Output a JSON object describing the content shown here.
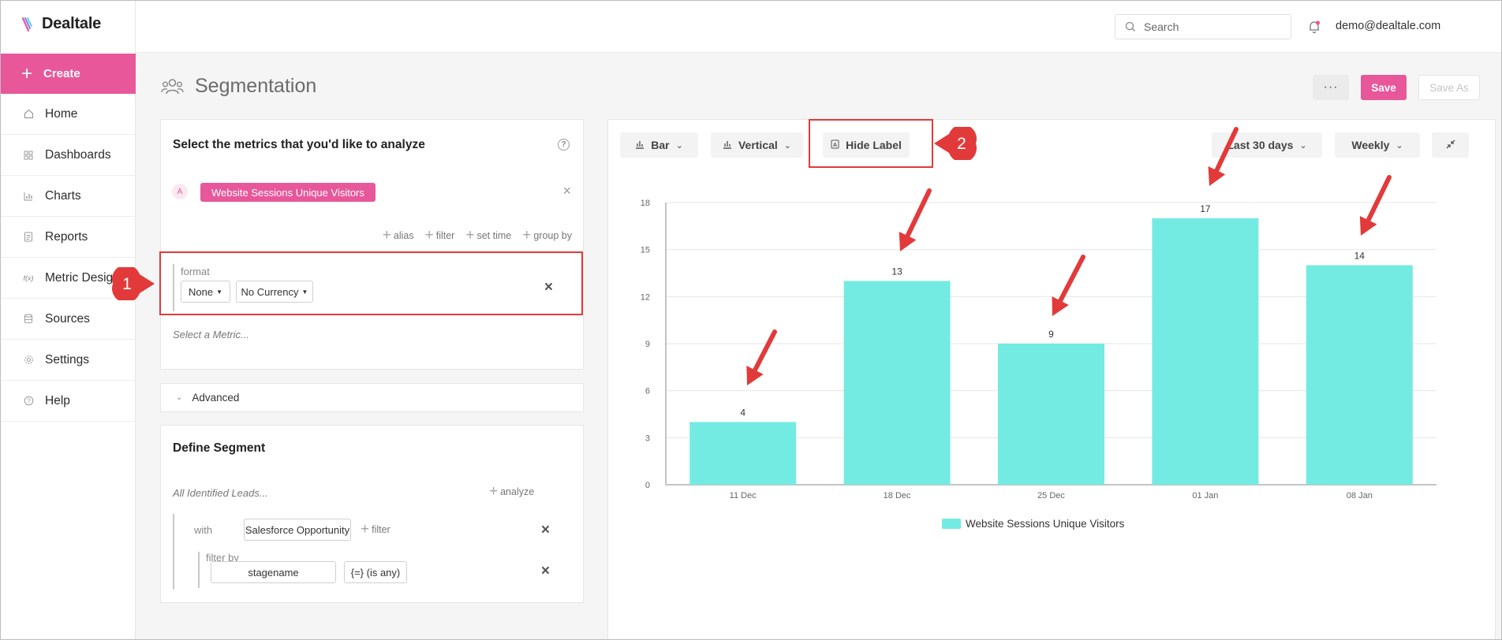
{
  "app": {
    "brand": "Dealtale"
  },
  "sidebar": {
    "create_label": "Create",
    "items": [
      {
        "label": "Home",
        "icon": "home-icon"
      },
      {
        "label": "Dashboards",
        "icon": "dashboards-icon"
      },
      {
        "label": "Charts",
        "icon": "charts-icon"
      },
      {
        "label": "Reports",
        "icon": "reports-icon"
      },
      {
        "label": "Metric Designer",
        "icon": "function-icon",
        "icon_text": "f(x)"
      },
      {
        "label": "Sources",
        "icon": "database-icon"
      },
      {
        "label": "Settings",
        "icon": "gear-icon"
      },
      {
        "label": "Help",
        "icon": "help-icon"
      }
    ]
  },
  "topbar": {
    "search_placeholder": "Search",
    "user_email": "demo@dealtale.com"
  },
  "page": {
    "title": "Segmentation",
    "more_label": "···",
    "save_label": "Save",
    "save_as_label": "Save As"
  },
  "metrics_panel": {
    "title": "Select the metrics that you'd like to analyze",
    "help_glyph": "?",
    "metric_letter": "A",
    "metric_name": "Website Sessions Unique Visitors",
    "actions": [
      "alias",
      "filter",
      "set time",
      "group by"
    ],
    "format_label": "format",
    "format_value": "None",
    "currency_value": "No Currency",
    "select_placeholder": "Select a Metric..."
  },
  "advanced": {
    "label": "Advanced"
  },
  "segment": {
    "title": "Define Segment",
    "leads_label": "All Identified Leads...",
    "analyze_label": "analyze",
    "with_label": "with",
    "with_value": "Salesforce Opportunity",
    "filter_label": "filter",
    "filter_by_label": "filter by",
    "filter_field": "stagename",
    "filter_op": "{=} (is any)"
  },
  "chart_toolbar": {
    "type_label": "Bar",
    "orientation_label": "Vertical",
    "hide_label": "Hide Label",
    "range_label": "Last 30 days",
    "interval_label": "Weekly"
  },
  "annotations": {
    "one": "1",
    "two": "2"
  },
  "colors": {
    "accent": "#e8579a",
    "bar": "#74ebe2",
    "annotation": "#e23a3a"
  },
  "chart_data": {
    "type": "bar",
    "categories": [
      "11 Dec",
      "18 Dec",
      "25 Dec",
      "01 Jan",
      "08 Jan"
    ],
    "series": [
      {
        "name": "Website Sessions Unique Visitors",
        "values": [
          4,
          13,
          9,
          17,
          14
        ]
      }
    ],
    "ylim": [
      0,
      18
    ],
    "yticks": [
      0,
      3,
      6,
      9,
      12,
      15,
      18
    ],
    "grid": true,
    "data_labels": true,
    "legend": "bottom"
  }
}
